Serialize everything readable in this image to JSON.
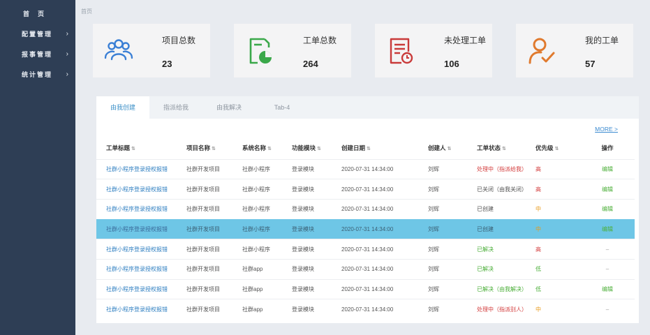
{
  "sidebar": {
    "home": "首页",
    "menus": [
      {
        "label": "配置管理",
        "chevron": "›"
      },
      {
        "label": "报事管理",
        "chevron": "›"
      },
      {
        "label": "统计管理",
        "chevron": "›"
      }
    ]
  },
  "breadcrumb": "首页",
  "cards": [
    {
      "title": "项目总数",
      "value": "23",
      "icon": "users-icon",
      "color": "#3a7fd5"
    },
    {
      "title": "工单总数",
      "value": "264",
      "icon": "document-chart-icon",
      "color": "#3aa84a"
    },
    {
      "title": "未处理工单",
      "value": "106",
      "icon": "document-clock-icon",
      "color": "#c93a3a"
    },
    {
      "title": "我的工单",
      "value": "57",
      "icon": "user-check-icon",
      "color": "#e07a2e"
    }
  ],
  "tabs": [
    "由我创建",
    "指派给我",
    "由我解决",
    "Tab-4"
  ],
  "more": "MORE >",
  "table": {
    "headers": [
      "工单标题",
      "项目名称",
      "系统名称",
      "功能模块",
      "创建日期",
      "创建人",
      "工单状态",
      "优先级",
      "操作"
    ],
    "rows": [
      {
        "title": "社群小程序登录授权报错",
        "project": "社群开发项目",
        "system": "社群小程序",
        "module": "登录模块",
        "date": "2020-07-31 14:34:00",
        "creator": "刘辉",
        "status": "处理中（指派给我）",
        "priority": "高",
        "action": "编辑"
      },
      {
        "title": "社群小程序登录授权报错",
        "project": "社群开发项目",
        "system": "社群小程序",
        "module": "登录模块",
        "date": "2020-07-31 14:34:00",
        "creator": "刘辉",
        "status": "已关闭（由我关闭）",
        "priority": "高",
        "action": "编辑"
      },
      {
        "title": "社群小程序登录授权报错",
        "project": "社群开发项目",
        "system": "社群小程序",
        "module": "登录模块",
        "date": "2020-07-31 14:34:00",
        "creator": "刘辉",
        "status": "已创建",
        "priority": "中",
        "action": "编辑"
      },
      {
        "title": "社群小程序登录授权报错",
        "project": "社群开发项目",
        "system": "社群小程序",
        "module": "登录模块",
        "date": "2020-07-31 14:34:00",
        "creator": "刘辉",
        "status": "已创建",
        "priority": "中",
        "action": "编辑"
      },
      {
        "title": "社群小程序登录授权报错",
        "project": "社群开发项目",
        "system": "社群小程序",
        "module": "登录模块",
        "date": "2020-07-31 14:34:00",
        "creator": "刘辉",
        "status": "已解决",
        "priority": "高",
        "action": "–"
      },
      {
        "title": "社群小程序登录授权报错",
        "project": "社群开发项目",
        "system": "社群app",
        "module": "登录模块",
        "date": "2020-07-31 14:34:00",
        "creator": "刘辉",
        "status": "已解决",
        "priority": "低",
        "action": "–"
      },
      {
        "title": "社群小程序登录授权报错",
        "project": "社群开发项目",
        "system": "社群app",
        "module": "登录模块",
        "date": "2020-07-31 14:34:00",
        "creator": "刘辉",
        "status": "已解决（由我解决）",
        "priority": "低",
        "action": "编辑"
      },
      {
        "title": "社群小程序登录授权报错",
        "project": "社群开发项目",
        "system": "社群app",
        "module": "登录模块",
        "date": "2020-07-31 14:34:00",
        "creator": "刘辉",
        "status": "处理中（指派别人）",
        "priority": "中",
        "action": "–"
      }
    ]
  }
}
